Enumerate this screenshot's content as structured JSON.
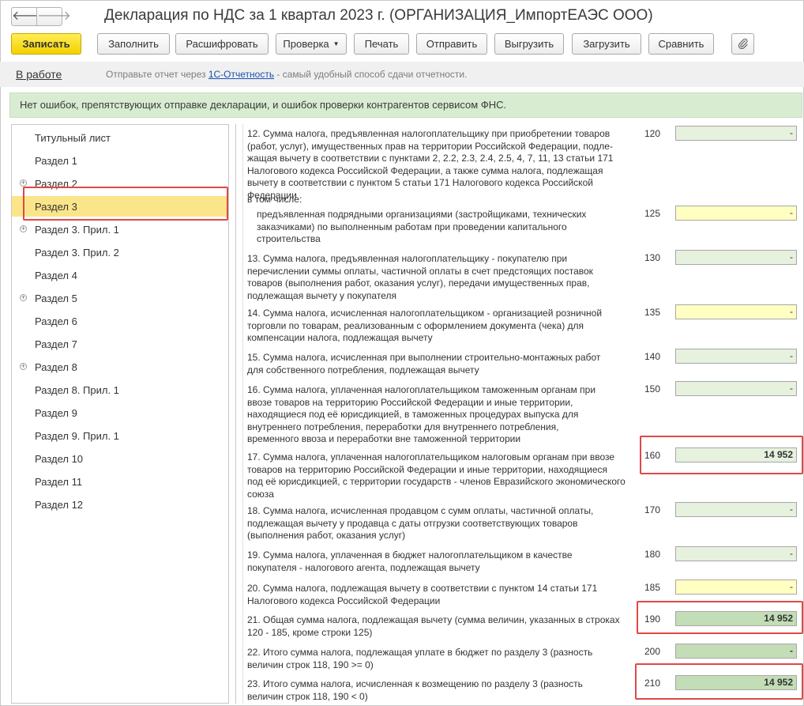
{
  "window": {
    "title": "Декларация по НДС за 1 квартал 2023 г. (ОРГАНИЗАЦИЯ_ИмпортЕАЭС ООО)",
    "back_glyph": "🡐",
    "forward_glyph": "🡒"
  },
  "toolbar": {
    "save": "Записать",
    "fill": "Заполнить",
    "decode": "Расшифровать",
    "check": "Проверка",
    "print": "Печать",
    "send": "Отправить",
    "export": "Выгрузить",
    "import": "Загрузить",
    "compare": "Сравнить",
    "attach_icon": "paperclip-icon"
  },
  "status": {
    "state": "В работе",
    "hint_prefix": "Отправьте отчет через ",
    "hint_link": "1С-Отчетность",
    "hint_suffix": " - самый удобный способ сдачи отчетности."
  },
  "banner": {
    "text": "Нет ошибок, препятствующих отправке декларации, и ошибок проверки контрагентов сервисом ФНС."
  },
  "sections": [
    {
      "label": "Титульный лист",
      "expandable": false
    },
    {
      "label": "Раздел 1",
      "expandable": false
    },
    {
      "label": "Раздел 2",
      "expandable": true
    },
    {
      "label": "Раздел 3",
      "expandable": false,
      "selected": true
    },
    {
      "label": "Раздел 3. Прил. 1",
      "expandable": true
    },
    {
      "label": "Раздел 3. Прил. 2",
      "expandable": false
    },
    {
      "label": "Раздел 4",
      "expandable": false
    },
    {
      "label": "Раздел 5",
      "expandable": true
    },
    {
      "label": "Раздел 6",
      "expandable": false
    },
    {
      "label": "Раздел 7",
      "expandable": false
    },
    {
      "label": "Раздел 8",
      "expandable": true
    },
    {
      "label": "Раздел 8. Прил. 1",
      "expandable": false
    },
    {
      "label": "Раздел 9",
      "expandable": false
    },
    {
      "label": "Раздел 9. Прил. 1",
      "expandable": false
    },
    {
      "label": "Раздел 10",
      "expandable": false
    },
    {
      "label": "Раздел 11",
      "expandable": false
    },
    {
      "label": "Раздел 12",
      "expandable": false
    }
  ],
  "rows": [
    {
      "text": "12. Сумма налога, предъявленная налогоплательщику при приобретении товаров\n(работ, услуг), имущественных прав на территории Российской Федерации, подле-\nжащая вычету в соответствии с пунктами 2, 2.2, 2.3, 2.4, 2.5, 4, 7, 11, 13 статьи 171\nНалогового кодекса Российской Федерации, а также сумма налога, подлежащая\nвычету в соответствии с пунктом 5 статьи 171 Налогового кодекса Российской Федерации",
      "code": "120",
      "value": "-",
      "field": "green"
    },
    {
      "text": "в том числе:",
      "code": "",
      "value": "",
      "field": "none"
    },
    {
      "text": "предъявленная подрядными организациями (застройщиками, технических\nзаказчиками) по выполненным работам при проведении капитального\nстроительства",
      "code": "125",
      "value": "-",
      "field": "yellow"
    },
    {
      "text": "13. Сумма налога, предъявленная налогоплательщику - покупателю при\nперечислении суммы оплаты, частичной оплаты в счет предстоящих поставок\nтоваров (выполнения работ, оказания услуг), передачи имущественных прав,\nподлежащая вычету у покупателя",
      "code": "130",
      "value": "-",
      "field": "green"
    },
    {
      "text": "14. Сумма налога, исчисленная налогоплательщиком - организацией розничной\nторговли по товарам, реализованным с оформлением документа (чека) для\nкомпенсации налога, подлежащая вычету",
      "code": "135",
      "value": "-",
      "field": "yellow"
    },
    {
      "text": "15. Сумма налога, исчисленная при выполнении строительно-монтажных работ\nдля собственного потребления, подлежащая вычету",
      "code": "140",
      "value": "-",
      "field": "green"
    },
    {
      "text": "16. Сумма налога, уплаченная налогоплательщиком таможенным органам при\nввозе товаров на территорию Российской Федерации и иные территории,\nнаходящиеся под её юрисдикцией, в таможенных процедурах выпуска для\nвнутреннего потребления, переработки для внутреннего потребления,\nвременного ввоза и переработки вне таможенной территории",
      "code": "150",
      "value": "-",
      "field": "green"
    },
    {
      "text": "17. Сумма налога, уплаченная налогоплательщиком налоговым органам при ввозе\nтоваров на территорию Российской Федерации и иные территории, находящиеся\nпод её юрисдикцией, с территории государств - членов Евразийского экономического\nсоюза",
      "code": "160",
      "value": "14 952",
      "field": "green-bold"
    },
    {
      "text": "18. Сумма налога, исчисленная продавцом с сумм оплаты, частичной оплаты,\nподлежащая вычету у продавца с даты отгрузки соответствующих товаров\n(выполнения работ, оказания услуг)",
      "code": "170",
      "value": "-",
      "field": "green"
    },
    {
      "text": "19. Сумма налога, уплаченная в бюджет налогоплательщиком в качестве\nпокупателя - налогового агента, подлежащая вычету",
      "code": "180",
      "value": "-",
      "field": "green"
    },
    {
      "text": "20. Сумма налога, подлежащая вычету в соответствии с пунктом 14 статьи 171\nНалогового кодекса Российской Федерации",
      "code": "185",
      "value": "-",
      "field": "yellow"
    },
    {
      "text": "21. Общая сумма налога, подлежащая вычету (сумма величин, указанных в строках\n120 - 185, кроме строки 125)",
      "code": "190",
      "value": "14 952",
      "field": "dark"
    },
    {
      "text": "22. Итого сумма налога, подлежащая уплате в бюджет по разделу 3 (разность\nвеличин строк 118, 190 >= 0)",
      "code": "200",
      "value": "-",
      "field": "dark"
    },
    {
      "text": "23. Итого сумма налога, исчисленная к возмещению по разделу 3 (разность\nвеличин строк 118, 190 < 0)",
      "code": "210",
      "value": "14 952",
      "field": "dark"
    }
  ]
}
